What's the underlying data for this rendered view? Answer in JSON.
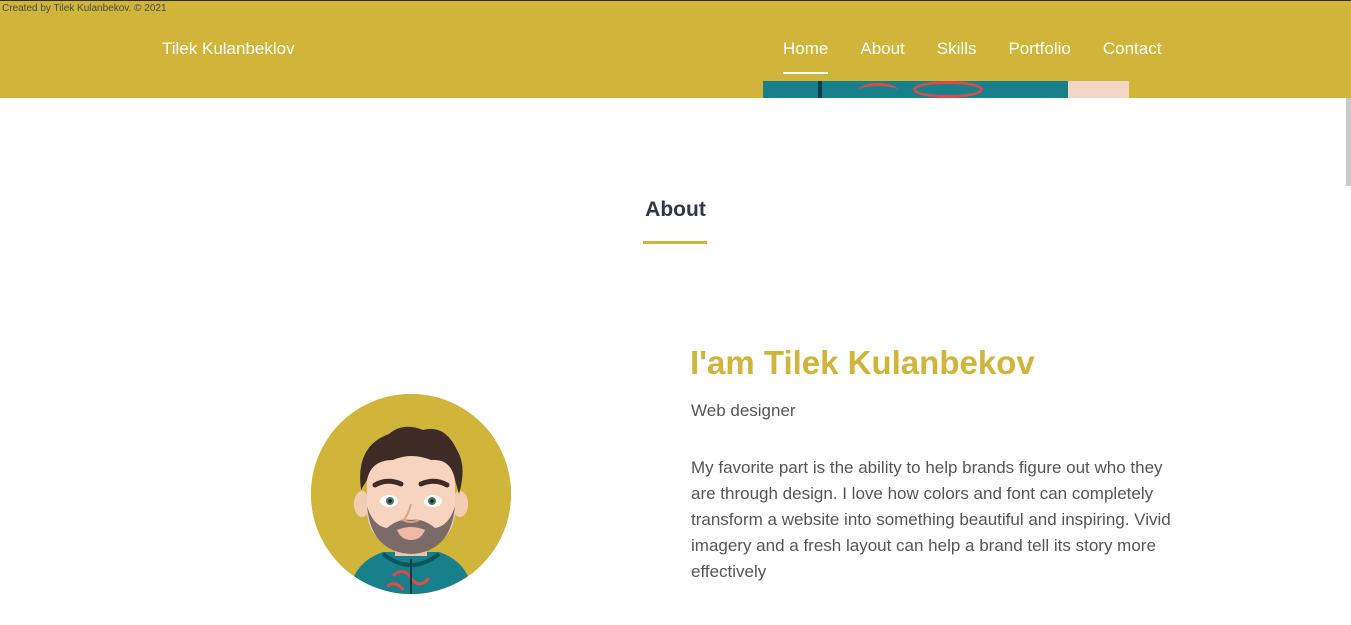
{
  "header": {
    "credit": "Created by Tilek Kulanbekov. © 2021",
    "brand": "Tilek Kulanbeklov",
    "nav": [
      {
        "label": "Home",
        "active": true
      },
      {
        "label": "About",
        "active": false
      },
      {
        "label": "Skills",
        "active": false
      },
      {
        "label": "Portfolio",
        "active": false
      },
      {
        "label": "Contact",
        "active": false
      }
    ]
  },
  "about": {
    "section_title": "About",
    "name": "I'am Tilek Kulanbekov",
    "role": "Web designer",
    "description": "My favorite part is the ability to help brands figure out who they are through design. I love how colors and font can completely transform a website into something beautiful and inspiring. Vivid imagery and a fresh layout can help a brand tell its story more effectively"
  },
  "colors": {
    "accent": "#d0b53a",
    "heading": "#2a3a4a",
    "body_text": "#555555",
    "shirt": "#17808a"
  },
  "icons": {
    "avatar": "cartoon-portrait-icon"
  }
}
